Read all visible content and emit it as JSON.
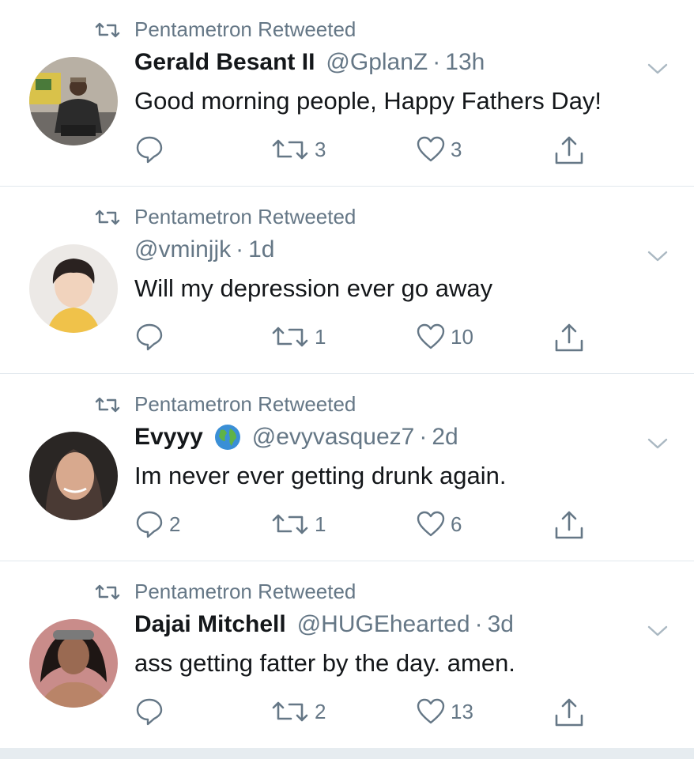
{
  "colors": {
    "text": "#14171a",
    "secondary": "#657786",
    "divider": "#e1e8ed"
  },
  "tweets": [
    {
      "retweeted_by": "Pentametron Retweeted",
      "name": "Gerald Besant II",
      "verified_emoji": "",
      "handle": "@GplanZ",
      "time": "13h",
      "text": "Good morning people, Happy Fathers Day!",
      "replies": "",
      "retweets": "3",
      "likes": "3"
    },
    {
      "retweeted_by": "Pentametron Retweeted",
      "name": "",
      "verified_emoji": "",
      "handle": "@vminjjk",
      "time": "1d",
      "text": "Will my depression ever go away",
      "replies": "",
      "retweets": "1",
      "likes": "10"
    },
    {
      "retweeted_by": "Pentametron Retweeted",
      "name": "Evyyy",
      "verified_emoji": "globe",
      "handle": "@evyvasquez7",
      "time": "2d",
      "text": "Im never ever getting drunk again.",
      "replies": "2",
      "retweets": "1",
      "likes": "6"
    },
    {
      "retweeted_by": "Pentametron Retweeted",
      "name": "Dajai Mitchell",
      "verified_emoji": "",
      "handle": "@HUGEhearted",
      "time": "3d",
      "text": "ass getting fatter by the day. amen.",
      "replies": "",
      "retweets": "2",
      "likes": "13"
    }
  ]
}
